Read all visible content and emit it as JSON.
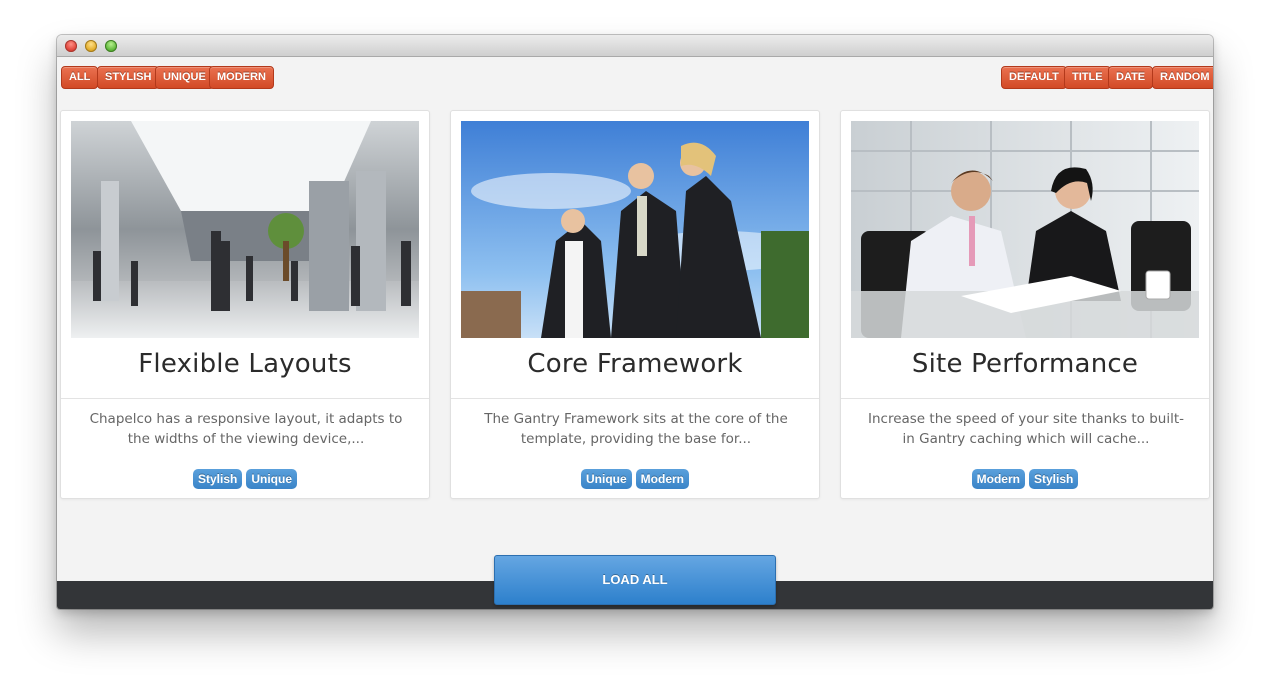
{
  "filters": {
    "all": "ALL",
    "stylish": "STYLISH",
    "unique": "UNIQUE",
    "modern": "MODERN"
  },
  "sorts": {
    "default": "DEFAULT",
    "title": "TITLE",
    "date": "DATE",
    "random": "RANDOM"
  },
  "cards": [
    {
      "title": "Flexible Layouts",
      "description": "Chapelco has a responsive layout, it adapts to the widths of the viewing device,...",
      "tags": [
        "Stylish",
        "Unique"
      ],
      "image_icon": "office-lobby-photo"
    },
    {
      "title": "Core Framework",
      "description": "The Gantry Framework sits at the core of the template, providing the base for...",
      "tags": [
        "Unique",
        "Modern"
      ],
      "image_icon": "business-team-photo"
    },
    {
      "title": "Site Performance",
      "description": "Increase the speed of your site thanks to built-in Gantry caching which will cache...",
      "tags": [
        "Modern",
        "Stylish"
      ],
      "image_icon": "meeting-photo"
    }
  ],
  "load_all": "LOAD ALL",
  "colors": {
    "filter_button": "#d9562f",
    "tag": "#4a92d3",
    "load_button": "#3a88d0",
    "footer": "#333538"
  }
}
